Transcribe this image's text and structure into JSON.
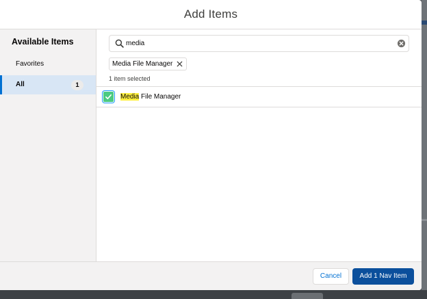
{
  "modal": {
    "title": "Add Items"
  },
  "sidebar": {
    "heading": "Available Items",
    "items": [
      {
        "label": "Favorites",
        "count": ""
      },
      {
        "label": "All",
        "count": "1",
        "active": true
      }
    ]
  },
  "search": {
    "value": "media",
    "placeholder": "Search"
  },
  "selection": {
    "pills": [
      {
        "label": "Media File Manager"
      }
    ],
    "count_text": "1 item selected"
  },
  "results": [
    {
      "match": "Media",
      "rest": " File Manager",
      "checked": true
    }
  ],
  "footer": {
    "cancel_label": "Cancel",
    "primary_label": "Add 1 Nav Item"
  },
  "colors": {
    "brand": "#0b4f9c",
    "accent_blue": "#0070d2",
    "check_green": "#4bca81",
    "highlight_yellow": "#fff03f",
    "active_bg": "#d8e6f5"
  },
  "icons": {
    "search": "search-icon",
    "clear": "clear-icon",
    "pill_remove": "close-icon",
    "checkbox": "check-icon"
  }
}
